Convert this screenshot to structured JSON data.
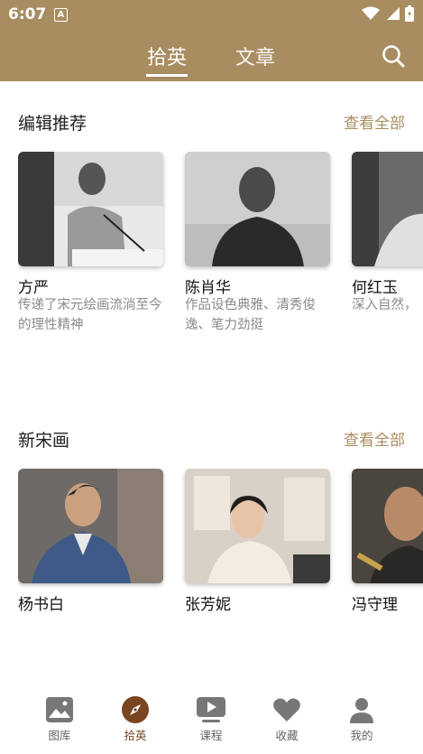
{
  "status": {
    "time": "6:07",
    "notif_letter": "A"
  },
  "header": {
    "tabs": [
      {
        "label": "拾英",
        "active": true
      },
      {
        "label": "文章",
        "active": false
      }
    ],
    "search_icon": "search-icon"
  },
  "sections": [
    {
      "title": "编辑推荐",
      "see_all": "查看全部",
      "cards": [
        {
          "name": "方严",
          "desc": "传递了宋元绘画流淌至今的理性精神"
        },
        {
          "name": "陈肖华",
          "desc": "作品设色典雅、清秀俊逸、笔力劲挺"
        },
        {
          "name": "何红玉",
          "desc": "深入自然，"
        }
      ]
    },
    {
      "title": "新宋画",
      "see_all": "查看全部",
      "cards": [
        {
          "name": "杨书白"
        },
        {
          "name": "张芳妮"
        },
        {
          "name": "冯守理"
        }
      ]
    }
  ],
  "nav": [
    {
      "label": "图库",
      "icon": "gallery-icon",
      "active": false
    },
    {
      "label": "拾英",
      "icon": "compass-icon",
      "active": true
    },
    {
      "label": "课程",
      "icon": "play-icon",
      "active": false
    },
    {
      "label": "收藏",
      "icon": "heart-icon",
      "active": false
    },
    {
      "label": "我的",
      "icon": "person-icon",
      "active": false
    }
  ],
  "colors": {
    "header": "#a88d60",
    "accent": "#a88d60",
    "active_nav": "#7a4520"
  }
}
